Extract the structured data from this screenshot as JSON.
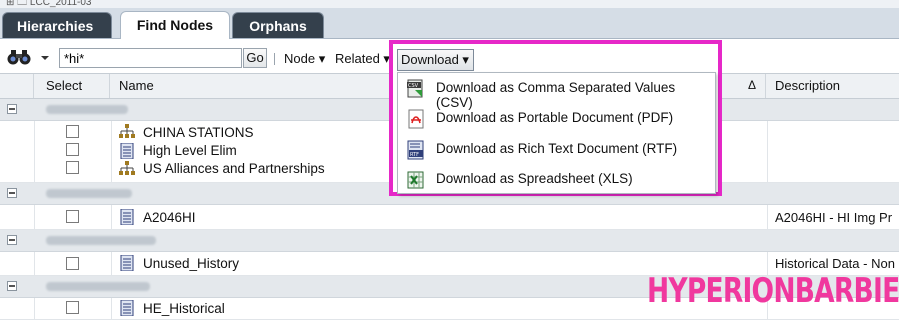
{
  "topstrip": {
    "cut_text": "⊞ 🗀 LCC_2011-03"
  },
  "tabs": [
    {
      "label": "Hierarchies"
    },
    {
      "label": "Find Nodes"
    },
    {
      "label": "Orphans"
    }
  ],
  "toolbar": {
    "search_value": "*hi*",
    "go_label": "Go",
    "node_label": "Node ▾",
    "related_label": "Related ▾",
    "download_label": "Download ▾"
  },
  "grid": {
    "columns": [
      "Select",
      "Name",
      "Description"
    ],
    "sort_indicator": "Δ",
    "rows": [
      {
        "name": "CHINA STATIONS",
        "description": ""
      },
      {
        "name": "High Level Elim",
        "description": ""
      },
      {
        "name": "US Alliances and Partnerships",
        "description": ""
      },
      {
        "name": "A2046HI",
        "description": "A2046HI - HI Img Pr"
      },
      {
        "name": "Unused_History",
        "description": "Historical Data - Non"
      },
      {
        "name": "HE_Historical",
        "description": ""
      }
    ]
  },
  "download_menu": {
    "items": [
      {
        "label": "Download as Comma Separated Values (CSV)",
        "icon": "csv-file-icon"
      },
      {
        "label": "Download as Portable Document (PDF)",
        "icon": "pdf-file-icon"
      },
      {
        "label": "Download as Rich Text Document (RTF)",
        "icon": "rtf-file-icon"
      },
      {
        "label": "Download as Spreadsheet (XLS)",
        "icon": "xls-file-icon"
      }
    ]
  },
  "watermark": {
    "text": "HYPERIONBARBIE"
  },
  "colors": {
    "highlight": "#e628c8",
    "watermark": "#f0389e",
    "tab_dark": "#34404c"
  }
}
